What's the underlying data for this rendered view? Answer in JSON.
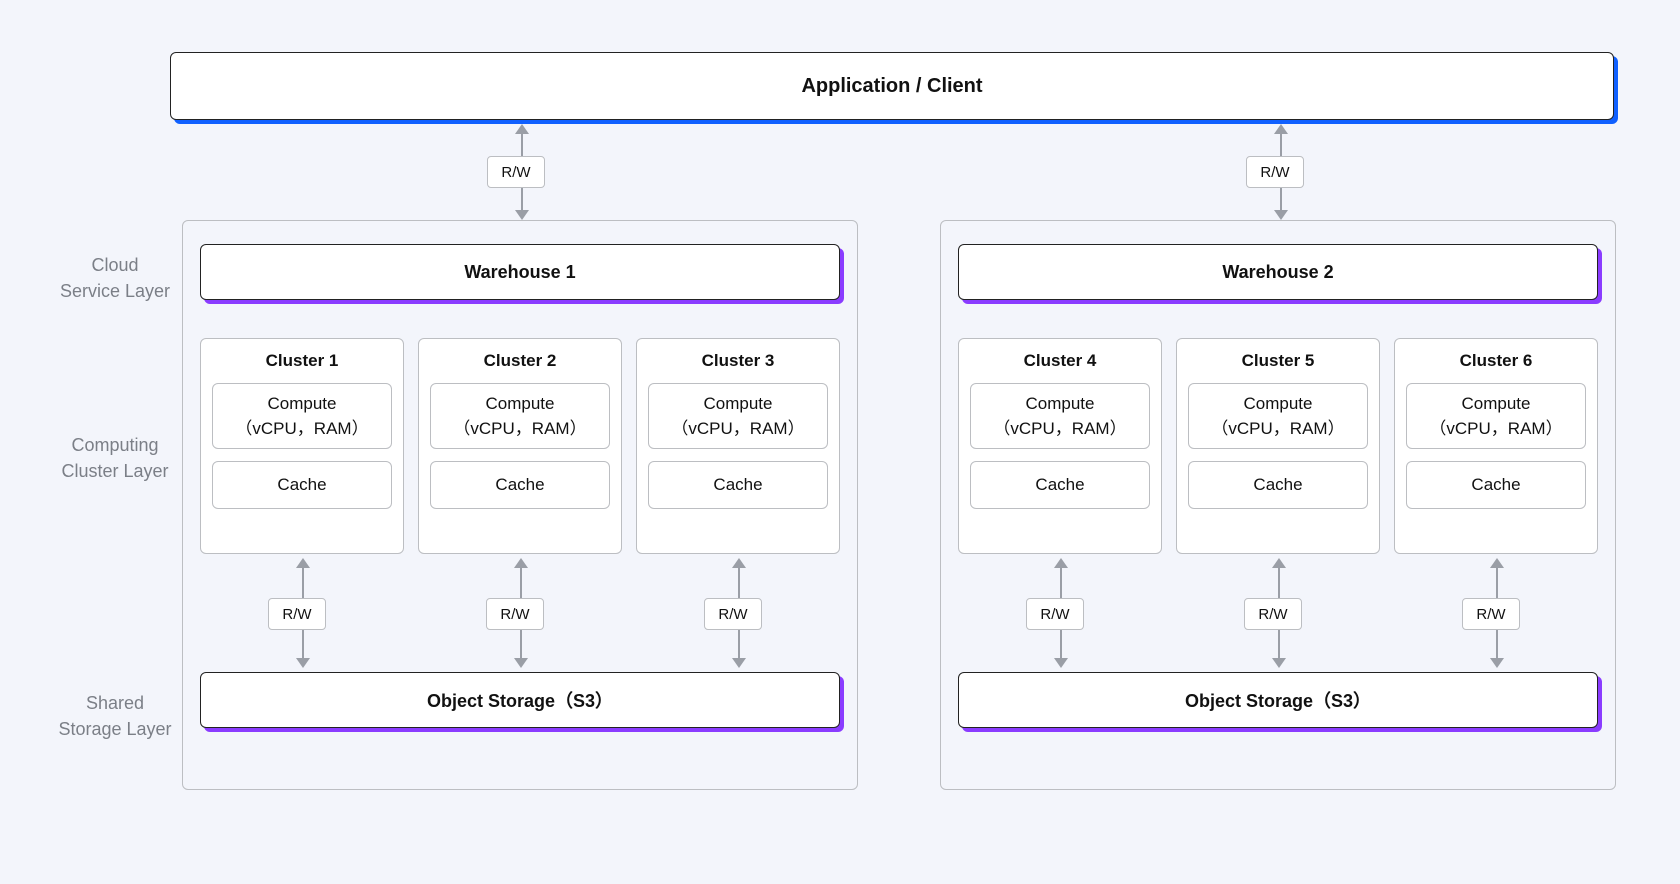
{
  "top": {
    "title": "Application / Client"
  },
  "labels": {
    "cloud": "Cloud\nService Layer",
    "compute": "Computing\nCluster Layer",
    "storage": "Shared\nStorage Layer",
    "rw": "R/W"
  },
  "warehouses": [
    {
      "name": "Warehouse 1",
      "storage": "Object Storage（S3）",
      "clusters": [
        {
          "name": "Cluster 1",
          "compute": "Compute\n（vCPU，RAM）",
          "cache": "Cache"
        },
        {
          "name": "Cluster 2",
          "compute": "Compute\n（vCPU，RAM）",
          "cache": "Cache"
        },
        {
          "name": "Cluster 3",
          "compute": "Compute\n（vCPU，RAM）",
          "cache": "Cache"
        }
      ]
    },
    {
      "name": "Warehouse 2",
      "storage": "Object Storage（S3）",
      "clusters": [
        {
          "name": "Cluster 4",
          "compute": "Compute\n（vCPU，RAM）",
          "cache": "Cache"
        },
        {
          "name": "Cluster 5",
          "compute": "Compute\n（vCPU，RAM）",
          "cache": "Cache"
        },
        {
          "name": "Cluster 6",
          "compute": "Compute\n（vCPU，RAM）",
          "cache": "Cache"
        }
      ]
    }
  ]
}
